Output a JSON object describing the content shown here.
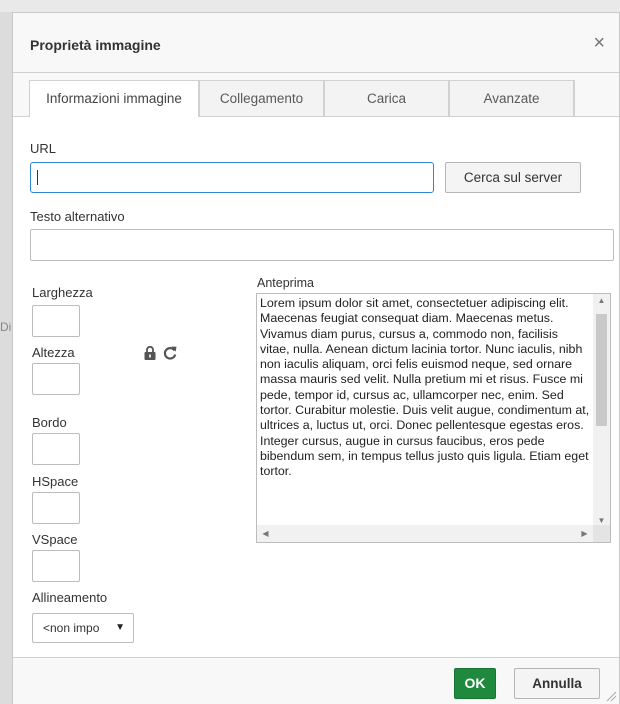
{
  "dialog": {
    "title": "Proprietà immagine",
    "close_glyph": "×"
  },
  "tabs": [
    {
      "label": "Informazioni immagine",
      "active": true
    },
    {
      "label": "Collegamento",
      "active": false
    },
    {
      "label": "Carica",
      "active": false
    },
    {
      "label": "Avanzate",
      "active": false
    }
  ],
  "backdrop": {
    "partial_text": "Di"
  },
  "form": {
    "url_label": "URL",
    "url_value": "",
    "browse_server_label": "Cerca sul server",
    "alt_label": "Testo alternativo",
    "alt_value": "",
    "width_label": "Larghezza",
    "height_label": "Altezza",
    "border_label": "Bordo",
    "hspace_label": "HSpace",
    "vspace_label": "VSpace",
    "align_label": "Allineamento",
    "align_selected": "<non impo"
  },
  "preview": {
    "label": "Anteprima",
    "text": "Lorem ipsum dolor sit amet, consectetuer adipiscing elit. Maecenas feugiat consequat diam. Maecenas metus. Vivamus diam purus, cursus a, commodo non, facilisis vitae, nulla. Aenean dictum lacinia tortor. Nunc iaculis, nibh non iaculis aliquam, orci felis euismod neque, sed ornare massa mauris sed velit. Nulla pretium mi et risus. Fusce mi pede, tempor id, cursus ac, ullamcorper nec, enim. Sed tortor. Curabitur molestie. Duis velit augue, condimentum at, ultrices a, luctus ut, orci. Donec pellentesque egestas eros. Integer cursus, augue in cursus faucibus, eros pede bibendum sem, in tempus tellus justo quis ligula. Etiam eget tortor."
  },
  "footer": {
    "ok_label": "OK",
    "cancel_label": "Annulla"
  },
  "colors": {
    "accent_ok": "#1f8a3e",
    "focus_border": "#2f86d6"
  }
}
